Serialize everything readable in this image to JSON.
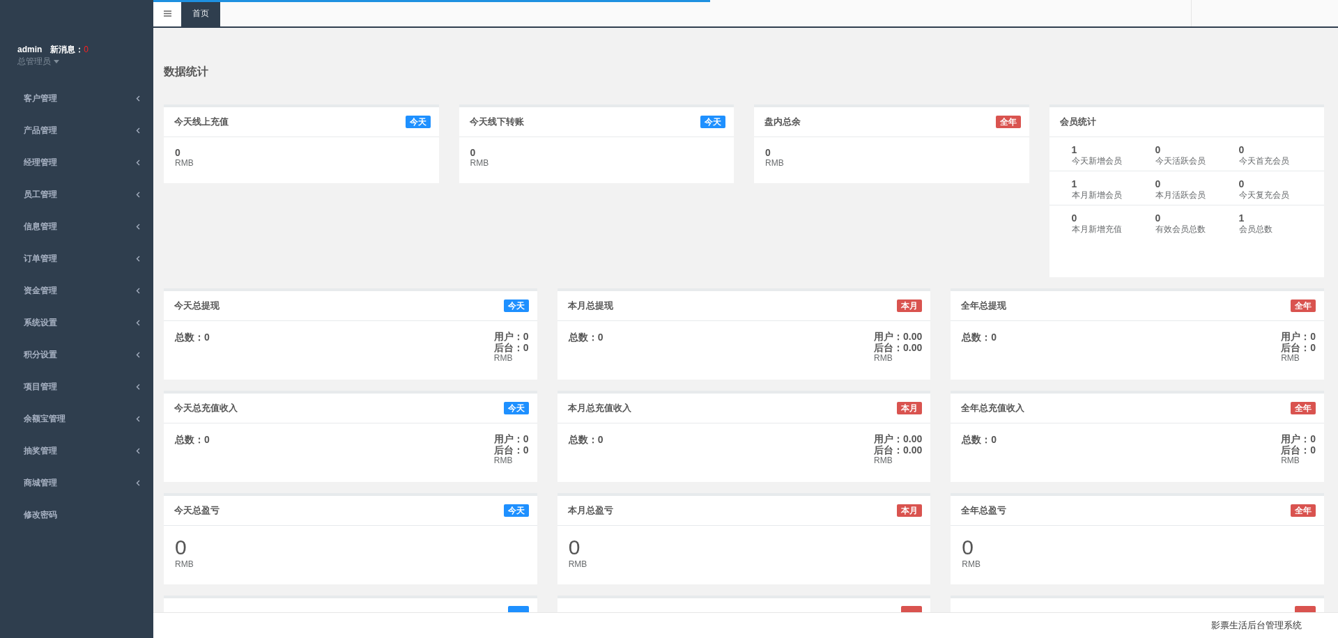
{
  "user": {
    "name": "admin",
    "message_label": "新消息：",
    "message_count": "0",
    "role": "总管理员"
  },
  "menu": [
    {
      "label": "客户管理",
      "has_children": true
    },
    {
      "label": "产品管理",
      "has_children": true
    },
    {
      "label": "经理管理",
      "has_children": true
    },
    {
      "label": "员工管理",
      "has_children": true
    },
    {
      "label": "信息管理",
      "has_children": true
    },
    {
      "label": "订单管理",
      "has_children": true
    },
    {
      "label": "资金管理",
      "has_children": true
    },
    {
      "label": "系统设置",
      "has_children": true
    },
    {
      "label": "积分设置",
      "has_children": true
    },
    {
      "label": "项目管理",
      "has_children": true
    },
    {
      "label": "余额宝管理",
      "has_children": true
    },
    {
      "label": "抽奖管理",
      "has_children": true
    },
    {
      "label": "商城管理",
      "has_children": true
    },
    {
      "label": "修改密码",
      "has_children": false
    }
  ],
  "loading_bar": {
    "level": 0.47
  },
  "tabs": [
    {
      "label": "首页",
      "selected": true
    }
  ],
  "page_title": "数据统计",
  "summary_cards": [
    {
      "title": "今天线上充值",
      "badge": {
        "label": "今天",
        "color": "#1e90ff"
      },
      "value": "0",
      "unit": "RMB"
    },
    {
      "title": "今天线下转账",
      "badge": {
        "label": "今天",
        "color": "#1e90ff"
      },
      "value": "0",
      "unit": "RMB"
    },
    {
      "title": "盘内总余",
      "badge": {
        "label": "全年",
        "color": "#d9534f"
      },
      "value": "0",
      "unit": "RMB"
    }
  ],
  "member_stats": {
    "title": "会员统计",
    "rows": [
      {
        "cells": [
          {
            "value": "1",
            "label": "今天新增会员"
          },
          {
            "value": "0",
            "label": "今天活跃会员"
          },
          {
            "value": "0",
            "label": "今天首充会员"
          }
        ]
      },
      {
        "cells": [
          {
            "value": "1",
            "label": "本月新增会员"
          },
          {
            "value": "0",
            "label": "本月活跃会员"
          },
          {
            "value": "0",
            "label": "今天复充会员"
          }
        ]
      },
      {
        "cells": [
          {
            "value": "0",
            "label": "本月新增充值"
          },
          {
            "value": "0",
            "label": "有效会员总数"
          },
          {
            "value": "1",
            "label": "会员总数"
          }
        ]
      }
    ]
  },
  "stat_cards": [
    {
      "kind": "split",
      "title": "今天总提现",
      "badge": {
        "label": "今天",
        "color": "#1e90ff"
      },
      "total": "总数：0",
      "user": "用户：0",
      "backend": "后台：0",
      "unit": "RMB"
    },
    {
      "kind": "split",
      "title": "本月总提现",
      "badge": {
        "label": "本月",
        "color": "#d9534f"
      },
      "total": "总数：0",
      "user": "用户：0.00",
      "backend": "后台：0.00",
      "unit": "RMB"
    },
    {
      "kind": "split",
      "title": "全年总提现",
      "badge": {
        "label": "全年",
        "color": "#d9534f"
      },
      "total": "总数：0",
      "user": "用户：0",
      "backend": "后台：0",
      "unit": "RMB"
    },
    {
      "kind": "split",
      "title": "今天总充值收入",
      "badge": {
        "label": "今天",
        "color": "#1e90ff"
      },
      "total": "总数：0",
      "user": "用户：0",
      "backend": "后台：0",
      "unit": "RMB"
    },
    {
      "kind": "split",
      "title": "本月总充值收入",
      "badge": {
        "label": "本月",
        "color": "#d9534f"
      },
      "total": "总数：0",
      "user": "用户：0.00",
      "backend": "后台：0.00",
      "unit": "RMB"
    },
    {
      "kind": "split",
      "title": "全年总充值收入",
      "badge": {
        "label": "全年",
        "color": "#d9534f"
      },
      "total": "总数：0",
      "user": "用户：0",
      "backend": "后台：0",
      "unit": "RMB"
    },
    {
      "kind": "big",
      "title": "今天总盈亏",
      "badge": {
        "label": "今天",
        "color": "#1e90ff"
      },
      "value": "0",
      "unit": "RMB"
    },
    {
      "kind": "big",
      "title": "本月总盈亏",
      "badge": {
        "label": "本月",
        "color": "#d9534f"
      },
      "value": "0",
      "unit": "RMB"
    },
    {
      "kind": "big",
      "title": "全年总盈亏",
      "badge": {
        "label": "全年",
        "color": "#d9534f"
      },
      "value": "0",
      "unit": "RMB"
    }
  ],
  "cut_cards": [
    {
      "color": "#1e90ff"
    },
    {
      "color": "#d9534f"
    },
    {
      "color": "#d9534f"
    }
  ],
  "footer": "影票生活后台管理系统"
}
